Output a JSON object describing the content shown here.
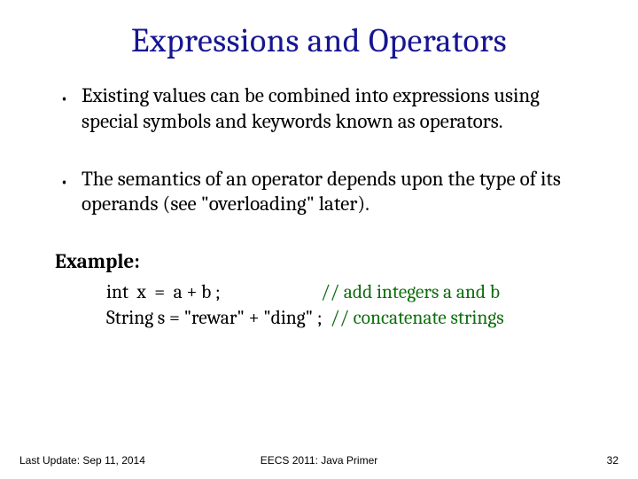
{
  "title": "Expressions and Operators",
  "bullets": [
    "Existing values can be combined into expressions using special symbols and keywords known as operators.",
    "The semantics of an operator depends upon the type of its operands (see \"overloading\" later)."
  ],
  "example": {
    "label": "Example:",
    "lines": [
      {
        "code": "int  x  =  a + b ;                        ",
        "comment": "// add integers a and b"
      },
      {
        "code": "String s = \"rewar\" + \"ding\" ;  ",
        "comment": "// concatenate strings"
      }
    ]
  },
  "footer": {
    "left": "Last Update: Sep 11, 2014",
    "center": "EECS 2011: Java Primer",
    "right": "32"
  }
}
